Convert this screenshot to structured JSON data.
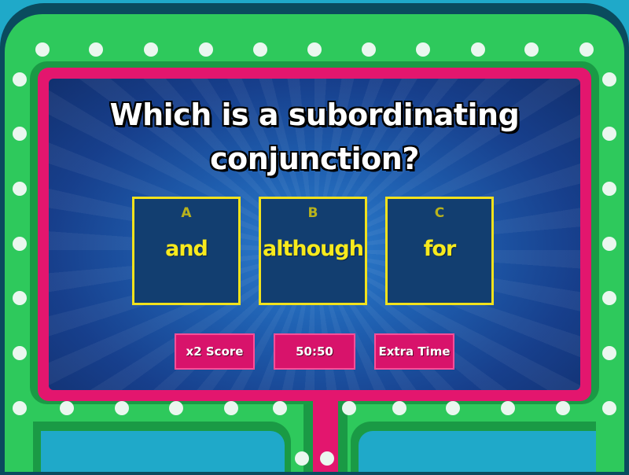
{
  "question": {
    "line1": "Which is a subordinating",
    "line2": "conjunction?"
  },
  "answers": [
    {
      "letter": "A",
      "text": "and"
    },
    {
      "letter": "B",
      "text": "although"
    },
    {
      "letter": "C",
      "text": "for"
    }
  ],
  "powerups": [
    {
      "label": "x2 Score"
    },
    {
      "label": "50:50"
    },
    {
      "label": "Extra Time"
    }
  ],
  "colors": {
    "frame_green": "#2ec95c",
    "frame_pink": "#e3166e",
    "answer_border": "#f2e21c",
    "answer_text": "#f7ea1d",
    "background": "#1fa9c9"
  }
}
